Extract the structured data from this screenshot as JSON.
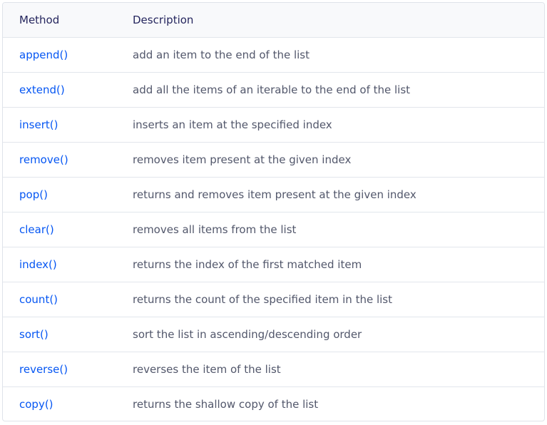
{
  "table": {
    "headers": {
      "method": "Method",
      "description": "Description"
    },
    "rows": [
      {
        "method": "append()",
        "description": "add an item to the end of the list"
      },
      {
        "method": "extend()",
        "description": "add all the items of an iterable to the end of the list"
      },
      {
        "method": "insert()",
        "description": "inserts an item at the specified index"
      },
      {
        "method": "remove()",
        "description": "removes item present at the given index"
      },
      {
        "method": "pop()",
        "description": "returns and removes item present at the given index"
      },
      {
        "method": "clear()",
        "description": "removes all items from the list"
      },
      {
        "method": "index()",
        "description": "returns the index of the first matched item"
      },
      {
        "method": "count()",
        "description": "returns the count of the specified item in the list"
      },
      {
        "method": "sort()",
        "description": "sort the list in ascending/descending order"
      },
      {
        "method": "reverse()",
        "description": "reverses the item of the list"
      },
      {
        "method": "copy()",
        "description": "returns the shallow copy of the list"
      }
    ]
  },
  "colors": {
    "method_link": "#0556f3",
    "header_text": "#25265e",
    "description_text": "#52576b",
    "header_background": "#f8f9fb",
    "border": "#e2e6ec"
  }
}
